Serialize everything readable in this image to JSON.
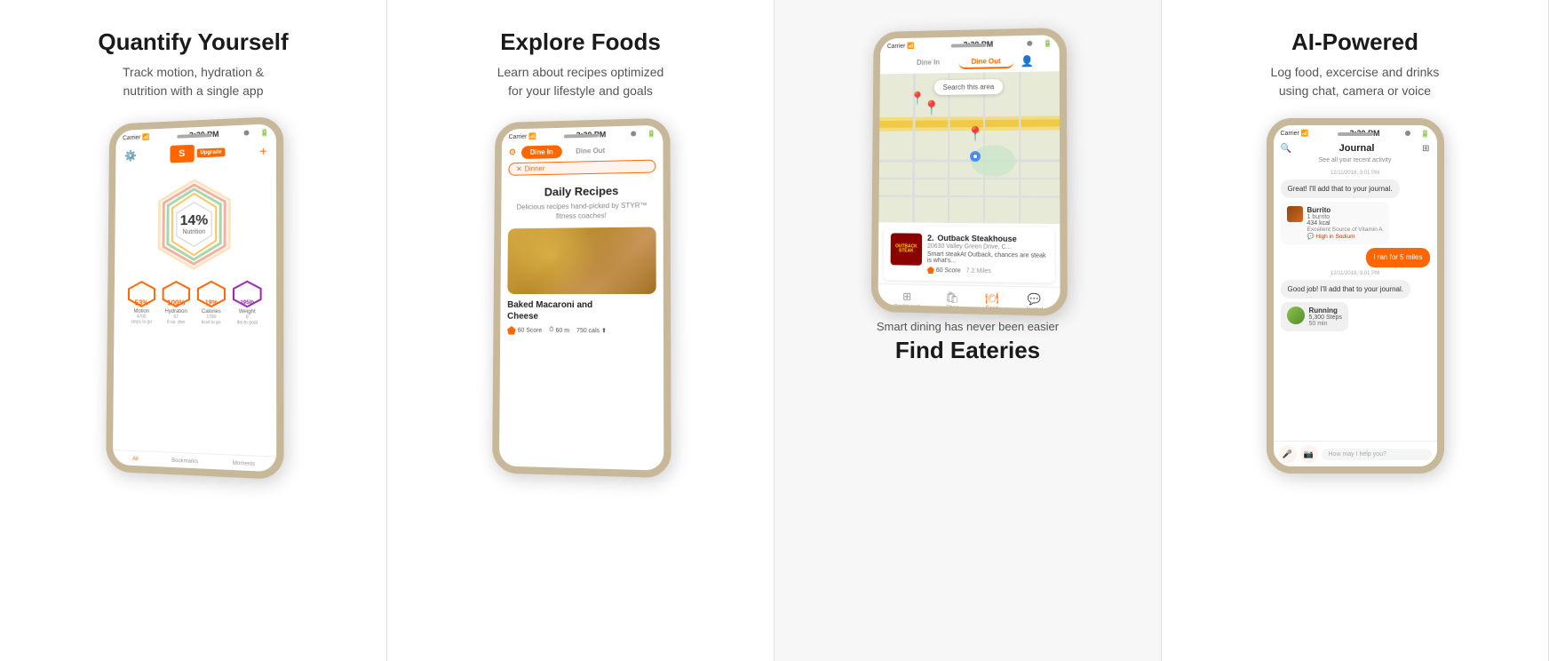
{
  "panels": [
    {
      "id": "panel1",
      "title": "Quantify Yourself",
      "subtitle": "Track motion, hydration &\nnutrition with a single app",
      "phone": {
        "statusTime": "3:20 PM",
        "logoText": "S",
        "upgradeText": "Upgrade",
        "mainStat": {
          "value": "14%",
          "label": "Nutrition"
        },
        "stats": [
          {
            "value": "53%",
            "label": "Motion",
            "sub": "4700\nsteps to go",
            "color": "#ff6600"
          },
          {
            "value": "100%",
            "label": "Hydration",
            "sub": "67\n8 oz. don",
            "color": "#ff6600"
          },
          {
            "value": "19%",
            "label": "Calories",
            "sub": "1789\nkcal to go",
            "color": "#ff6600"
          },
          {
            "value": "195lb",
            "label": "Weight",
            "sub": "8\nlbs to goal",
            "color": "#9c27b0"
          }
        ],
        "tabs": [
          "All",
          "Bookmarks",
          "Moments"
        ]
      }
    },
    {
      "id": "panel2",
      "title": "Explore Foods",
      "subtitle": "Learn about recipes optimized\nfor your lifestyle and goals",
      "phone": {
        "statusTime": "3:20 PM",
        "filterTabs": [
          "Dine In",
          "Dine Out"
        ],
        "activeFilter": "Dine In",
        "tag": "Dinner",
        "recipeTitle": "Daily Recipes",
        "recipeSub": "Delicious recipes hand-picked by STYR™ fitness coaches!",
        "foodName": "Baked Macaroni and\nCheese",
        "score": "60 Score",
        "time": "60 m",
        "cals": "750 cals"
      }
    },
    {
      "id": "panel3",
      "subtitle": "Smart dining has never been easier",
      "title": "Find Eateries",
      "phone": {
        "statusTime": "3:20 PM",
        "searchText": "Search this area",
        "dineTabs": [
          "Dine In",
          "Dine Out"
        ],
        "activeTab": "Dine Out",
        "restaurant": {
          "rank": "2.",
          "name": "Outback Steakhouse",
          "address": "20630 Valley Green Drive, C...",
          "desc": "Smart steakAt Outback, chances are steak is what's...",
          "score": "60 Score",
          "logoLines": [
            "OUTBACK",
            "STEAKHOUSE"
          ]
        },
        "navItems": [
          "Dashboard",
          "Shop",
          "Food",
          "Journal"
        ]
      }
    },
    {
      "id": "panel4",
      "title": "AI-Powered",
      "subtitle": "Log food, excercise and drinks\nusing chat, camera or voice",
      "phone": {
        "statusTime": "3:20 PM",
        "journalTitle": "Journal",
        "journalSub": "See all your recent activity",
        "messages": [
          {
            "type": "timestamp",
            "text": "12/11/2018, 3:01 PM"
          },
          {
            "type": "left",
            "text": "Great! I'll add that to your journal."
          },
          {
            "type": "food",
            "name": "Burrito",
            "qty": "1 burrito",
            "kcal": "434 kcal",
            "note": "Excellent Source of Vitamin A",
            "warning": "High in Sodium"
          },
          {
            "type": "right",
            "text": "I ran for 5 miles"
          },
          {
            "type": "timestamp",
            "text": "12/11/2018, 3:01 PM"
          },
          {
            "type": "left",
            "text": "Good job! I'll add that to your journal."
          },
          {
            "type": "activity",
            "name": "Running",
            "steps": "5,300 Steps",
            "duration": "50 min"
          }
        ],
        "inputPlaceholder": "How may I help you?"
      }
    }
  ],
  "colors": {
    "orange": "#ff6600",
    "purple": "#9c27b0",
    "blue": "#4285f4",
    "darkRed": "#8B0000"
  }
}
